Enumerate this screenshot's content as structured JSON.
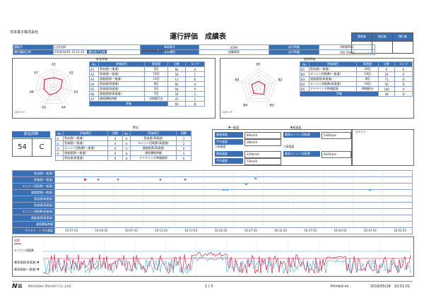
{
  "company": "日本電子株式会社",
  "title": "運行評価　成績表",
  "approval": {
    "labels": [
      "管理者",
      "検討者",
      "運行者"
    ]
  },
  "info": {
    "driver_label": "運転手",
    "driver_value": "山田太郎",
    "start_label": "運行開始日時",
    "start_value": "2016/04/01 15:52:43",
    "end_label": "運行終了日時",
    "end_value": "2016/04/01 19:00:47",
    "vehicle_label": "車両番号",
    "vehicle_value": "4599",
    "vehicle_name_label": "車両種別",
    "vehicle_name_value": "試験車両",
    "time_label": "走行時間",
    "time_value": "2時間56分",
    "distance_label": "走行距離",
    "distance_value": "105.56km"
  },
  "safety": {
    "caption": "安全評価",
    "radar_labels": [
      "A1",
      "A2",
      "A3",
      "A4",
      "A5",
      "A6",
      "A7"
    ],
    "radar_values": [
      0.5,
      0.6,
      0.4,
      0.35,
      0.5,
      0.55,
      0.65
    ],
    "headers": [
      "No",
      "評価項目",
      "実測値",
      "点数",
      "ランク"
    ],
    "rows": [
      [
        "A1",
        "急加速(一般道)",
        "5回",
        "84",
        "A"
      ],
      [
        "A2",
        "急減速(一般道)",
        "15回",
        "50",
        "C"
      ],
      [
        "A3",
        "速度超過(一般道)",
        "21回",
        "11",
        "E"
      ],
      [
        "A4",
        "急加速(高速道)",
        "6回",
        "80",
        "A"
      ],
      [
        "A5",
        "急減速(高速道)",
        "2回",
        "94",
        "A"
      ],
      [
        "A6",
        "速度超過(高速道)",
        "7回",
        "59",
        "C"
      ],
      [
        "A7",
        "連続運転時間",
        "2時間25分",
        "47",
        "C"
      ]
    ],
    "total_label": "評価",
    "total_score": "60",
    "total_rank": "B",
    "comment_label": "コメント"
  },
  "economy": {
    "caption": "経済評価",
    "radar_labels": [
      "B1",
      "B2",
      "B3",
      "B4",
      "B5"
    ],
    "radar_values": [
      0.3,
      0.35,
      0.5,
      0.45,
      0.4
    ],
    "headers": [
      "No",
      "評価項目",
      "実測値",
      "点数",
      "ランク"
    ],
    "rows": [
      [
        "B1",
        "急加速(一般道)",
        "20回",
        "0",
        "E"
      ],
      [
        "B2",
        "エンジン回転数(一般道)",
        "14回",
        "20",
        "E"
      ],
      [
        "B3",
        "速度超過(高速道)",
        "8回",
        "71",
        "D"
      ],
      [
        "B4",
        "エンジン回転数(高速道)",
        "10回",
        "50",
        "D"
      ],
      [
        "B5",
        "アイドリング時間超過",
        "0時間0分",
        "100",
        "A"
      ]
    ],
    "total_label": "評価",
    "total_score": "48",
    "total_rank": "D",
    "comment_label": "コメント"
  },
  "overall": {
    "label": "総合評価",
    "score": "54",
    "rank": "C"
  },
  "counts": {
    "caption": "警告",
    "headers": [
      "No",
      "評価項目",
      "回数",
      "No",
      "評価項目",
      "回数"
    ],
    "rows": [
      [
        "①",
        "急加速(一般道)",
        "0",
        "⑤",
        "急加速(高速道)",
        "1"
      ],
      [
        "②",
        "急減速(一般道)",
        "4",
        "⑥",
        "エンジン回転数(高速道)",
        "2"
      ],
      [
        "③",
        "エンジン回転数(一般道)",
        "0",
        "⑦",
        "速度超過(高速道)",
        "0"
      ],
      [
        "④",
        "速度超過(一般道)",
        "0",
        "⑧",
        "連続運転時間",
        "1"
      ],
      [
        "",
        "急加速(高速道)",
        "0",
        "⑨",
        "アイドリング時間超過",
        "0"
      ]
    ]
  },
  "stats": {
    "general_caption": "▼一般道",
    "highway_caption": "▼高速道",
    "max_speed_general_label": "最高速度",
    "max_speed_general": "80km/h",
    "avg_speed_general_label": "平均速度",
    "avg_speed_general": "38km/h",
    "highway_sub": "▽高速道",
    "max_speed_highway_label": "最高速度",
    "max_speed_highway": "120km/h",
    "avg_speed_highway_label": "平均速度",
    "avg_speed_highway": "72km/h",
    "max_rpm_general_label": "最高エンジン回転数",
    "max_rpm_general": "5440rpm",
    "max_rpm_highway_sub": "▽高速道",
    "max_rpm_highway_label": "最高エンジン回転数",
    "max_rpm_highway": "6020rpm",
    "comment_label": "コメント"
  },
  "events": {
    "labels": [
      "急加速(一般道)",
      "急減速(一般道)",
      "エンジン回転数(一般道)",
      "速度超過(一般道)",
      "急加速(高速道)",
      "急減速(高速道)",
      "エンジン回転数(高速道)",
      "速度超過(高速道)",
      "連続運転時間",
      "アイドリング時間超過"
    ]
  },
  "time_axis": [
    "15:52:43",
    "15:57:43",
    "16:02:43",
    "16:07:43",
    "16:12:43",
    "16:17:43",
    "16:22:43",
    "16:27:43",
    "16:32:43",
    "16:37:43",
    "16:42:43",
    "16:47:43",
    "16:52:43"
  ],
  "graph": {
    "legend": [
      "速度",
      "エンジン回転数",
      "最高速度(高速道) ▼",
      "最高速度(一般道) ▼"
    ]
  },
  "colors": {
    "header": "#3b6fb3",
    "speed": "#d0103a",
    "rpm": "#3aaee0"
  },
  "footer": {
    "brand": "Nichiden Denshi Co.,Ltd.",
    "page": "1 / 3",
    "printed_label": "Printed on :",
    "printed_value": "2016/05/18　10:51:01"
  }
}
